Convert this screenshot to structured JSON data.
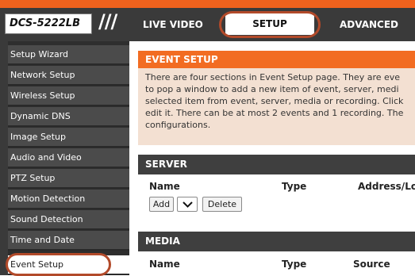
{
  "header": {
    "model": "DCS-5222LB",
    "divider": "///",
    "tabs": [
      "LIVE VIDEO",
      "SETUP",
      "ADVANCED"
    ]
  },
  "sidebar": {
    "items": [
      {
        "label": "Setup Wizard"
      },
      {
        "label": "Network Setup"
      },
      {
        "label": "Wireless Setup"
      },
      {
        "label": "Dynamic DNS"
      },
      {
        "label": "Image Setup"
      },
      {
        "label": "Audio and Video"
      },
      {
        "label": "PTZ Setup"
      },
      {
        "label": "Motion Detection"
      },
      {
        "label": "Sound Detection"
      },
      {
        "label": "Time and Date"
      },
      {
        "label": "Event Setup"
      }
    ]
  },
  "main": {
    "title": "EVENT SETUP",
    "description": [
      "There are four sections in Event Setup page. They are eve",
      "to pop a window to add a new item of event, server, medi",
      "selected item from event, server, media or recording. Click",
      "edit it. There can be at most 2 events and 1 recording. The",
      "configurations."
    ],
    "server": {
      "title": "SERVER",
      "columns": [
        "Name",
        "Type",
        "Address/Lo"
      ],
      "add_label": "Add",
      "delete_label": "Delete"
    },
    "media": {
      "title": "MEDIA",
      "columns": [
        "Name",
        "Type",
        "Source"
      ]
    }
  },
  "colors": {
    "accent": "#f26c22",
    "highlight_ring": "#b24a2a",
    "sidebar_bg": "#4b4b4b",
    "header_bg": "#3a3a3a"
  }
}
